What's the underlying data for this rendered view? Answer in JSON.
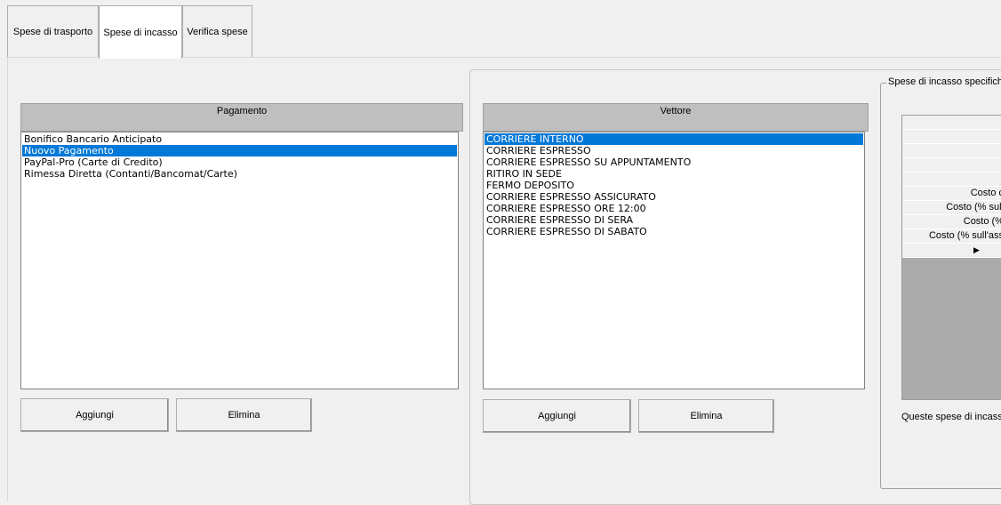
{
  "tabs": [
    {
      "label": "Spese di trasporto"
    },
    {
      "label": "Spese di incasso"
    },
    {
      "label": "Verifica spese"
    }
  ],
  "left": {
    "header": "Pagamento",
    "items": [
      "Bonifico Bancario Anticipato",
      "Nuovo Pagamento",
      "PayPal-Pro (Carte di Credito)",
      "Rimessa Diretta (Contanti/Bancomat/Carte)"
    ],
    "selected_index": 1,
    "add_label": "Aggiungi",
    "delete_label": "Elimina"
  },
  "middle": {
    "header": "Vettore",
    "items": [
      "CORRIERE INTERNO",
      "CORRIERE ESPRESSO",
      "CORRIERE ESPRESSO SU APPUNTAMENTO",
      "RITIRO IN SEDE",
      "FERMO DEPOSITO",
      "CORRIERE ESPRESSO ASSICURATO",
      "CORRIERE ESPRESSO ORE 12:00",
      "CORRIERE ESPRESSO DI SERA",
      "CORRIERE ESPRESSO DI SABATO"
    ],
    "selected_index": 0,
    "add_label": "Aggiungi",
    "delete_label": "Elimina"
  },
  "right": {
    "group_title": "Spese di incasso specifiche",
    "grid_rows": [
      "",
      "",
      "",
      "",
      "",
      "Costo c",
      "Costo (% sull",
      "Costo (%",
      "Costo (% sull'ass"
    ],
    "row_marker": "▶",
    "note": "Queste spese di incasso"
  },
  "colors": {
    "selection": "#0078d7",
    "header_bg": "#bfbfbf",
    "window_bg": "#f0f0f0"
  }
}
